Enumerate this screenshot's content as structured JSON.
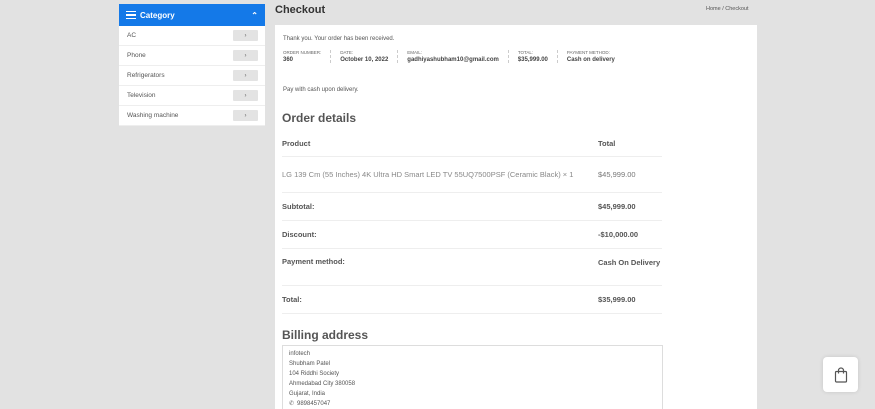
{
  "sidebar": {
    "header_label": "Category",
    "items": [
      {
        "label": "AC",
        "arrow": "›"
      },
      {
        "label": "Phone",
        "arrow": "›"
      },
      {
        "label": "Refrigerators",
        "arrow": "›"
      },
      {
        "label": "Television",
        "arrow": "›"
      },
      {
        "label": "Washing machine",
        "arrow": "›"
      }
    ]
  },
  "header": {
    "title": "Checkout",
    "breadcrumb_home": "Home",
    "breadcrumb_sep": "/",
    "breadcrumb_current": "Checkout"
  },
  "order": {
    "thanks": "Thank you. Your order has been received.",
    "summary": [
      {
        "label": "ORDER NUMBER:",
        "value": "360"
      },
      {
        "label": "DATE:",
        "value": "October 10, 2022"
      },
      {
        "label": "EMAIL:",
        "value": "gadhiyashubham10@gmail.com"
      },
      {
        "label": "TOTAL:",
        "value": "$35,999.00"
      },
      {
        "label": "PAYMENT METHOD:",
        "value": "Cash on delivery"
      }
    ],
    "pay_note": "Pay with cash upon delivery."
  },
  "details": {
    "heading": "Order details",
    "col_product": "Product",
    "col_total": "Total",
    "item_name": "LG 139 Cm (55 Inches) 4K Ultra HD Smart LED TV 55UQ7500PSF (Ceramic Black) × 1",
    "item_total": "$45,999.00",
    "subtotal_label": "Subtotal:",
    "subtotal_value": "$45,999.00",
    "discount_label": "Discount:",
    "discount_value": "-$10,000.00",
    "pm_label": "Payment method:",
    "pm_value": "Cash On Delivery",
    "total_label": "Total:",
    "total_value": "$35,999.00"
  },
  "billing": {
    "heading": "Billing address",
    "lines": [
      "infotech",
      "Shubham Patel",
      "104 Riddhi Society",
      "Ahmedabad City 380058",
      "Gujarat, India"
    ],
    "phone": "9898457047"
  },
  "colors": {
    "accent": "#1479e8",
    "background": "#e2e2e2"
  },
  "icons": {
    "menu": "hamburger-icon",
    "collapse": "chevron-up-icon",
    "cart": "shopping-bag-icon",
    "phone": "phone-icon"
  }
}
